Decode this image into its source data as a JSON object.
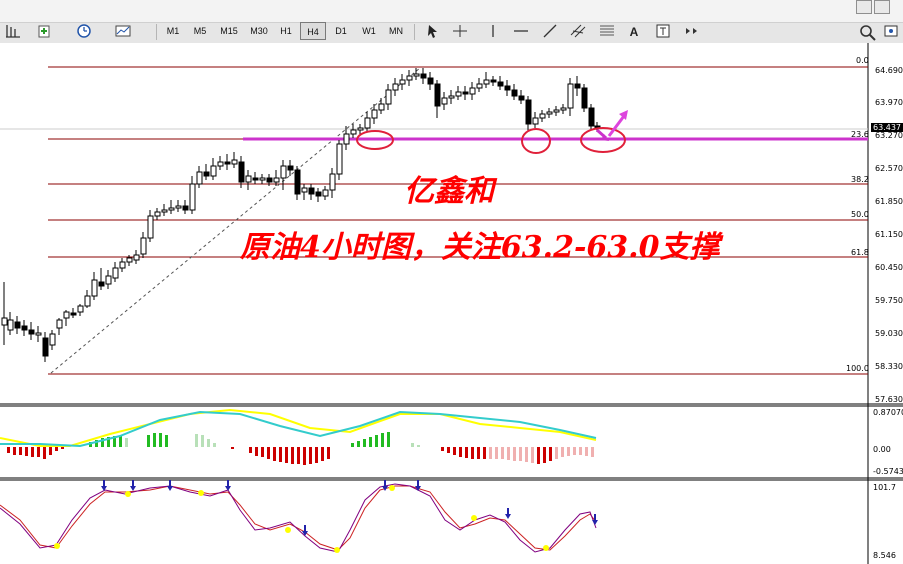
{
  "window_buttons": [
    "minimize",
    "restore"
  ],
  "toolbar": {
    "timeframes": [
      "M1",
      "M5",
      "M15",
      "M30",
      "H1",
      "H4",
      "D1",
      "W1",
      "MN"
    ],
    "active_timeframe": "H4",
    "text_tool_label": "A",
    "icons": [
      "new-chart-icon",
      "new-order-icon",
      "clock-icon",
      "chart-template-icon",
      "cursor-icon",
      "crosshair-icon",
      "vertical-line-icon",
      "horizontal-line-icon",
      "trendline-icon",
      "channel-icon",
      "fibonacci-icon",
      "text-icon",
      "text-label-icon",
      "arrows-icon",
      "search-icon",
      "navigator-icon"
    ]
  },
  "main_chart": {
    "price_axis": [
      "64.690",
      "63.970",
      "63.270",
      "62.570",
      "61.850",
      "61.150",
      "60.450",
      "59.750",
      "59.030",
      "58.330",
      "57.630"
    ],
    "current_price": "63.437",
    "fib_levels": [
      {
        "label": "0.0"
      },
      {
        "label": "23.6"
      },
      {
        "label": "38.2"
      },
      {
        "label": "50.0"
      },
      {
        "label": "61.8"
      },
      {
        "label": "100.0"
      }
    ],
    "colors": {
      "fib": "#8b0000",
      "support": "#cc33cc",
      "bull": "#ffffff",
      "bear": "#000000",
      "annotation": "#ff0000"
    }
  },
  "annotation": {
    "title": "亿鑫和",
    "text": "原油4小时图，关注63.2-63.0支撑"
  },
  "macd_panel": {
    "axis": [
      "0.87070",
      "0.00",
      "-0.5743"
    ],
    "colors": {
      "signal": "#ffff00",
      "main": "#33cccc",
      "up": "#22bb22",
      "down": "#cc0000"
    }
  },
  "stoch_panel": {
    "axis": [
      "101.7",
      "8.546"
    ],
    "colors": {
      "k": "#800080",
      "d": "#cc2222",
      "arrow_down": "#2222aa",
      "arrow_up": "#ffff00"
    }
  }
}
